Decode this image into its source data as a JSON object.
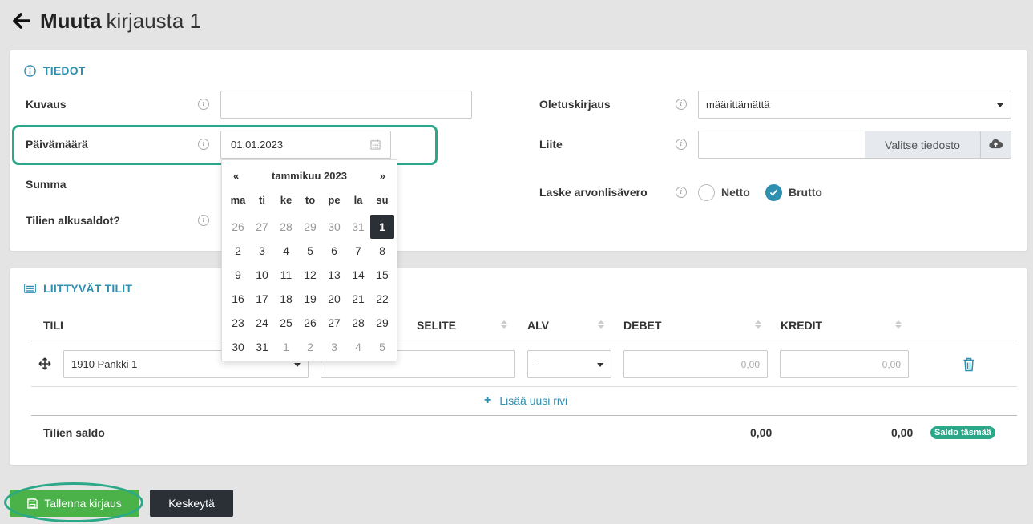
{
  "header": {
    "title_strong": "Muuta",
    "title_light": "kirjausta 1"
  },
  "tiedot": {
    "title": "TIEDOT",
    "kuvaus_label": "Kuvaus",
    "kuvaus_value": "",
    "paivamaara_label": "Päivämäärä",
    "paivamaara_value": "01.01.2023",
    "summa_label": "Summa",
    "alkusaldot_label": "Tilien alkusaldot?",
    "oletuskirjaus_label": "Oletuskirjaus",
    "oletuskirjaus_value": "määrittämättä",
    "liite_label": "Liite",
    "liite_button": "Valitse tiedosto",
    "alv_label": "Laske arvonlisävero",
    "netto_label": "Netto",
    "brutto_label": "Brutto"
  },
  "datepicker": {
    "prev": "«",
    "next": "»",
    "month_title": "tammikuu 2023",
    "weekdays": [
      "ma",
      "ti",
      "ke",
      "to",
      "pe",
      "la",
      "su"
    ],
    "days": [
      [
        "26",
        "27",
        "28",
        "29",
        "30",
        "31",
        "1"
      ],
      [
        "2",
        "3",
        "4",
        "5",
        "6",
        "7",
        "8"
      ],
      [
        "9",
        "10",
        "11",
        "12",
        "13",
        "14",
        "15"
      ],
      [
        "16",
        "17",
        "18",
        "19",
        "20",
        "21",
        "22"
      ],
      [
        "23",
        "24",
        "25",
        "26",
        "27",
        "28",
        "29"
      ],
      [
        "30",
        "31",
        "1",
        "2",
        "3",
        "4",
        "5"
      ]
    ],
    "selected": "1"
  },
  "tilit": {
    "title": "LIITTYVÄT TILIT",
    "columns": {
      "tili": "TILI",
      "selite": "SELITE",
      "alv": "ALV",
      "debet": "DEBET",
      "kredit": "KREDIT"
    },
    "row": {
      "tili": "1910 Pankki 1",
      "selite": "",
      "alv": "-",
      "debet_placeholder": "0,00",
      "kredit_placeholder": "0,00"
    },
    "add_row": "Lisää uusi rivi",
    "saldo_label": "Tilien saldo",
    "saldo_debet": "0,00",
    "saldo_kredit": "0,00",
    "saldo_badge": "Saldo täsmää"
  },
  "buttons": {
    "save": "Tallenna kirjaus",
    "cancel": "Keskeytä"
  },
  "colors": {
    "accent": "#2f8fb0",
    "success": "#4bb24a",
    "dark": "#2b2f36",
    "highlight": "#2aa889"
  }
}
